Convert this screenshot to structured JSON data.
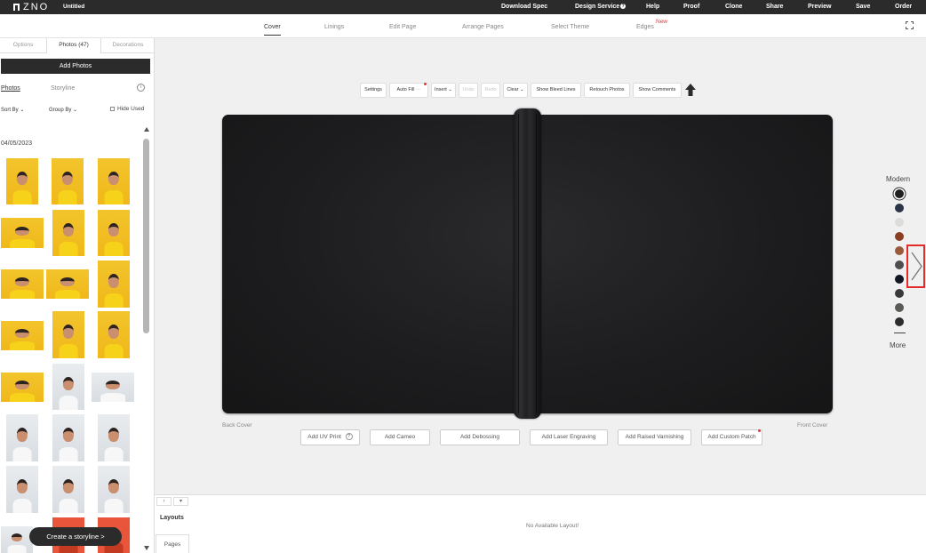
{
  "app": {
    "logo_text": "ZNO",
    "doc_title": "Untitled"
  },
  "topnav": {
    "download_spec": "Download Spec",
    "design_service": "Design Service",
    "help": "Help",
    "proof": "Proof",
    "clone": "Clone",
    "share": "Share",
    "preview": "Preview",
    "save": "Save",
    "order": "Order"
  },
  "main_tabs": {
    "cover": "Cover",
    "linings": "Linings",
    "edit_page": "Edit Page",
    "arrange_pages": "Arrange Pages",
    "select_theme": "Select Theme",
    "edges": "Edges",
    "new_badge": "New",
    "active": "cover"
  },
  "left_panel": {
    "tabs": {
      "options": "Options",
      "photos": "Photos (47)",
      "decorations": "Decorations"
    },
    "add_photos": "Add Photos",
    "sub_tabs": {
      "photos": "Photos",
      "storyline": "Storyline"
    },
    "info_icon": "i",
    "sort_by": "Sort By ⌄",
    "group_by": "Group By ⌄",
    "hide_used": "Hide Used",
    "date_group": "04/05/2023",
    "create_storyline": "Create a storyline >"
  },
  "toolbar": {
    "settings": "Settings",
    "auto_fill": "Auto Fill",
    "auto_fill_more": "···",
    "insert": "Insert ⌄",
    "undo": "Undo",
    "redo": "Redo",
    "clear": "Clear ⌄",
    "show_bleed_lines": "Show Bleed Lines",
    "retouch_photos": "Retouch Photos",
    "show_comments": "Show Comments"
  },
  "canvas": {
    "back_cover": "Back Cover",
    "front_cover": "Front Cover",
    "cover_color": "#1f1f21"
  },
  "add_buttons": {
    "uv_print": "Add UV Print",
    "uv_print_help": "?",
    "cameo": "Add Cameo",
    "debossing": "Add Debossing",
    "laser_engraving": "Add Laser Engraving",
    "raised_varnishing": "Add Raised Varnishing",
    "custom_patch": "Add Custom Patch"
  },
  "palette": {
    "title": "Modern",
    "swatches": [
      "#1f1f21",
      "#2c3547",
      "#dcdcda",
      "#8a3f24",
      "#9a5a3c",
      "#4e4e50",
      "#121722",
      "#3a3a3a",
      "#5c5a56",
      "#2e2c2b"
    ],
    "selected_index": 0,
    "more": "More"
  },
  "bottom_panel": {
    "prev": "‹",
    "expand": "▾",
    "layouts_label": "Layouts",
    "pages_tab": "Pages",
    "no_layout": "No Available Layout!"
  },
  "accent": {
    "highlight_red": "#e52a2a",
    "dark": "#2b2b2b"
  }
}
